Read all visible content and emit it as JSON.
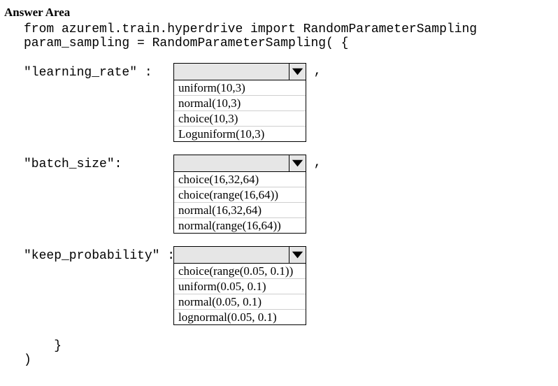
{
  "title": "Answer Area",
  "code": {
    "line1": "from azureml.train.hyperdrive import RandomParameterSampling",
    "line2": "param_sampling = RandomParameterSampling( {"
  },
  "params": [
    {
      "label": "\"learning_rate\" :",
      "trailing": " ,",
      "options": [
        "uniform(10,3)",
        "normal(10,3)",
        "choice(10,3)",
        "Loguniform(10,3)"
      ]
    },
    {
      "label": "\"batch_size\":",
      "trailing": " ,",
      "options": [
        "choice(16,32,64)",
        "choice(range(16,64))",
        "normal(16,32,64)",
        "normal(range(16,64))"
      ]
    },
    {
      "label": "\"keep_probability\" :",
      "trailing": "",
      "options": [
        "choice(range(0.05, 0.1))",
        "uniform(0.05, 0.1)",
        "normal(0.05, 0.1)",
        "lognormal(0.05, 0.1)"
      ]
    }
  ],
  "closing": {
    "brace": "    }",
    "paren": ")"
  }
}
